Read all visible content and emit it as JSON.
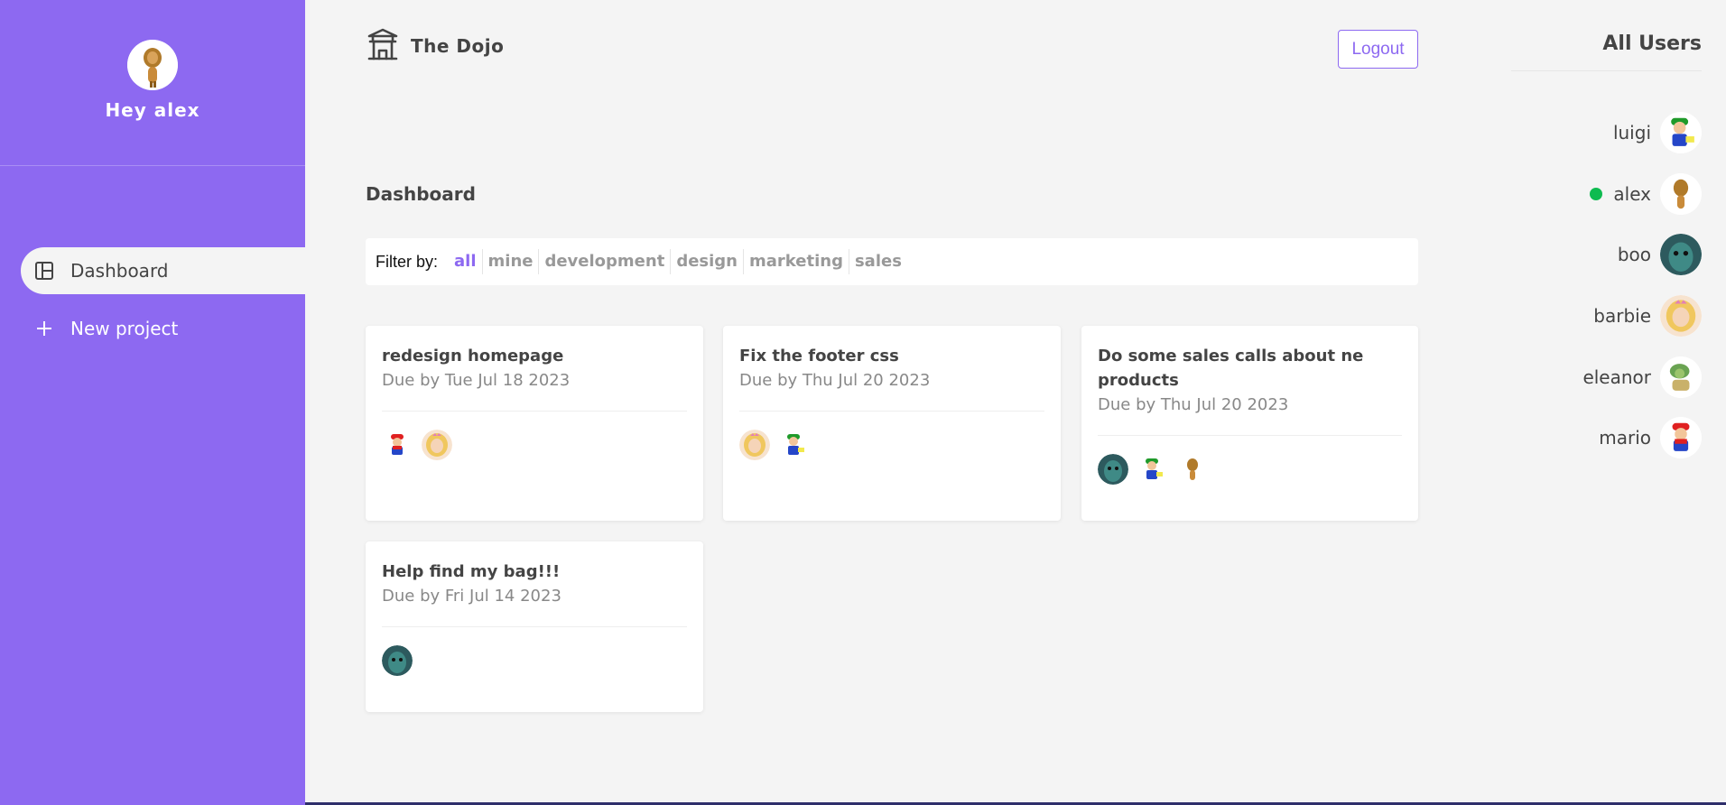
{
  "sidebar": {
    "greeting": "Hey alex",
    "nav": [
      {
        "label": "Dashboard",
        "icon": "dashboard-icon",
        "active": true
      },
      {
        "label": "New project",
        "icon": "plus-icon",
        "active": false
      }
    ]
  },
  "header": {
    "brand": "The Dojo",
    "logout_label": "Logout"
  },
  "main": {
    "title": "Dashboard",
    "filter": {
      "label": "Filter by:",
      "options": [
        "all",
        "mine",
        "development",
        "design",
        "marketing",
        "sales"
      ],
      "active": "all"
    },
    "projects": [
      {
        "title": "redesign homepage",
        "due": "Due by Tue Jul 18 2023",
        "assignees": [
          "mario",
          "barbie"
        ]
      },
      {
        "title": "Fix the footer css",
        "due": "Due by Thu Jul 20 2023",
        "assignees": [
          "barbie",
          "luigi"
        ]
      },
      {
        "title": "Do some sales calls about ne products",
        "due": "Due by Thu Jul 20 2023",
        "assignees": [
          "boo",
          "luigi",
          "alex"
        ]
      },
      {
        "title": "Help find my bag!!!",
        "due": "Due by Fri Jul 14 2023",
        "assignees": [
          "boo"
        ]
      }
    ]
  },
  "users_panel": {
    "title": "All Users",
    "users": [
      {
        "name": "luigi",
        "online": false
      },
      {
        "name": "alex",
        "online": true
      },
      {
        "name": "boo",
        "online": false
      },
      {
        "name": "barbie",
        "online": false
      },
      {
        "name": "eleanor",
        "online": false
      },
      {
        "name": "mario",
        "online": false
      }
    ]
  },
  "colors": {
    "accent": "#8d69f1",
    "background": "#f4f4f4",
    "online": "#0ebb50"
  }
}
